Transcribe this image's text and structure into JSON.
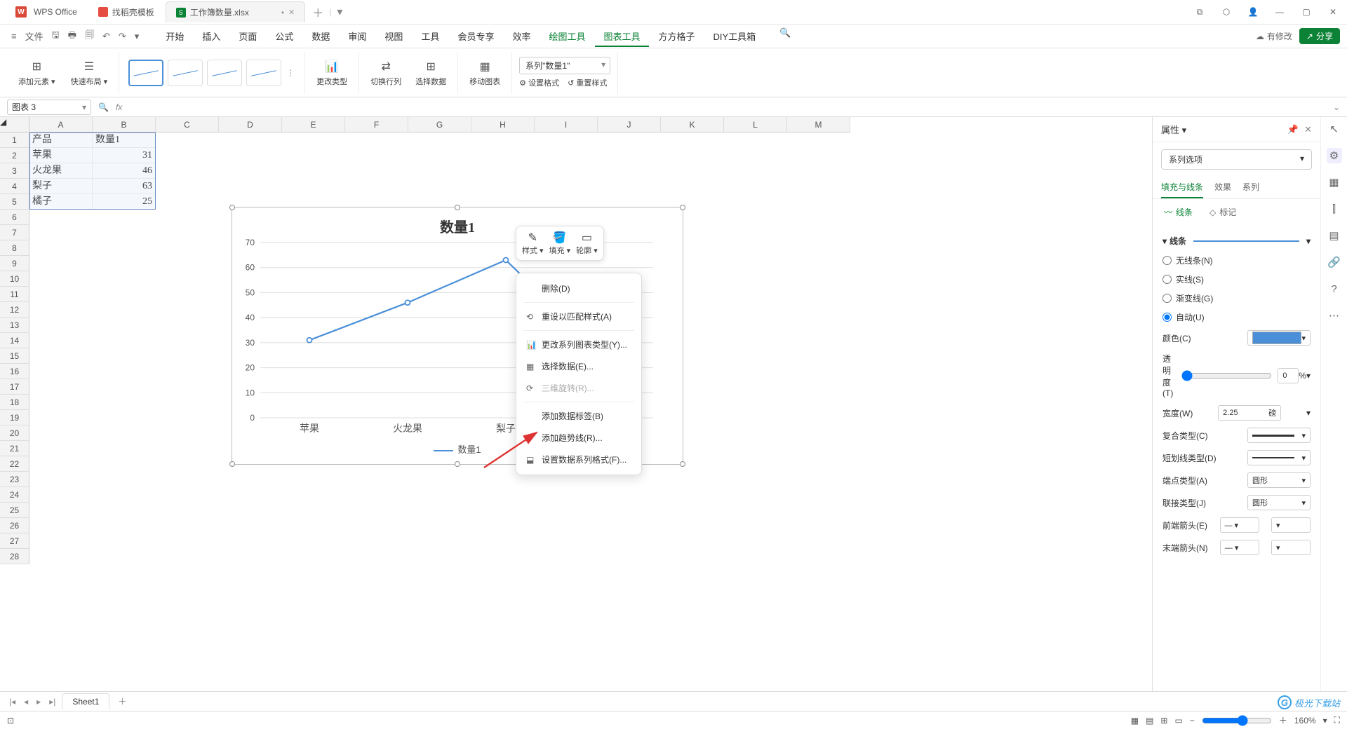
{
  "title_tabs": {
    "wps": "WPS Office",
    "templates": "找稻壳模板",
    "doc": "工作簿数量.xlsx"
  },
  "quick_access": {
    "file": "文件"
  },
  "menu": [
    "开始",
    "插入",
    "页面",
    "公式",
    "数据",
    "审阅",
    "视图",
    "工具",
    "会员专享",
    "效率"
  ],
  "menu_extra": [
    "绘图工具",
    "图表工具",
    "方方格子",
    "DIY工具箱"
  ],
  "menu_right": {
    "modify": "有修改",
    "share": "分享"
  },
  "ribbon": {
    "add_element": "添加元素",
    "quick_layout": "快速布局",
    "change_type": "更改类型",
    "switch_rc": "切换行列",
    "select_data": "选择数据",
    "move_chart": "移动图表",
    "set_format": "设置格式",
    "reset_style": "重置样式",
    "series_selector": "系列\"数量1\""
  },
  "name_box": "图表 3",
  "columns": [
    "A",
    "B",
    "C",
    "D",
    "E",
    "F",
    "G",
    "H",
    "I",
    "J",
    "K",
    "L",
    "M"
  ],
  "rows": 28,
  "table": {
    "headers": [
      "产品",
      "数量1"
    ],
    "data": [
      [
        "苹果",
        "31"
      ],
      [
        "火龙果",
        "46"
      ],
      [
        "梨子",
        "63"
      ],
      [
        "橘子",
        "25"
      ]
    ]
  },
  "chart_data": {
    "type": "line",
    "title": "数量1",
    "categories": [
      "苹果",
      "火龙果",
      "梨子",
      "橘子"
    ],
    "series": [
      {
        "name": "数量1",
        "values": [
          31,
          46,
          63,
          25
        ]
      }
    ],
    "ylim": [
      0,
      70
    ],
    "ystep": 10,
    "legend": "数量1"
  },
  "mini_toolbar": {
    "style": "样式",
    "fill": "填充",
    "outline": "轮廓"
  },
  "context_menu": {
    "delete": "删除(D)",
    "reset_style": "重设以匹配样式(A)",
    "change_series_type": "更改系列图表类型(Y)...",
    "select_data": "选择数据(E)...",
    "rotate_3d": "三维旋转(R)...",
    "add_labels": "添加数据标签(B)",
    "add_trendline": "添加趋势线(R)...",
    "format_series": "设置数据系列格式(F)..."
  },
  "props": {
    "header": "属性",
    "series_opts": "系列选项",
    "tabs": [
      "填充与线条",
      "效果",
      "系列"
    ],
    "subtabs": {
      "line": "线条",
      "marker": "标记"
    },
    "section_line": "线条",
    "radio": {
      "none": "无线条(N)",
      "solid": "实线(S)",
      "gradient": "渐变线(G)",
      "auto": "自动(U)"
    },
    "color": "颜色(C)",
    "opacity": "透明度(T)",
    "opacity_val": "0",
    "opacity_unit": "%",
    "width": "宽度(W)",
    "width_val": "2.25",
    "width_unit": "磅",
    "compound": "复合类型(C)",
    "dash": "短划线类型(D)",
    "cap": "端点类型(A)",
    "cap_val": "圆形",
    "join": "联接类型(J)",
    "join_val": "圆形",
    "arrow_start": "前端箭头(E)",
    "arrow_end": "末端箭头(N)"
  },
  "sheet_tabs": {
    "sheet1": "Sheet1"
  },
  "status": {
    "zoom": "160%"
  },
  "watermark": "极光下载站"
}
